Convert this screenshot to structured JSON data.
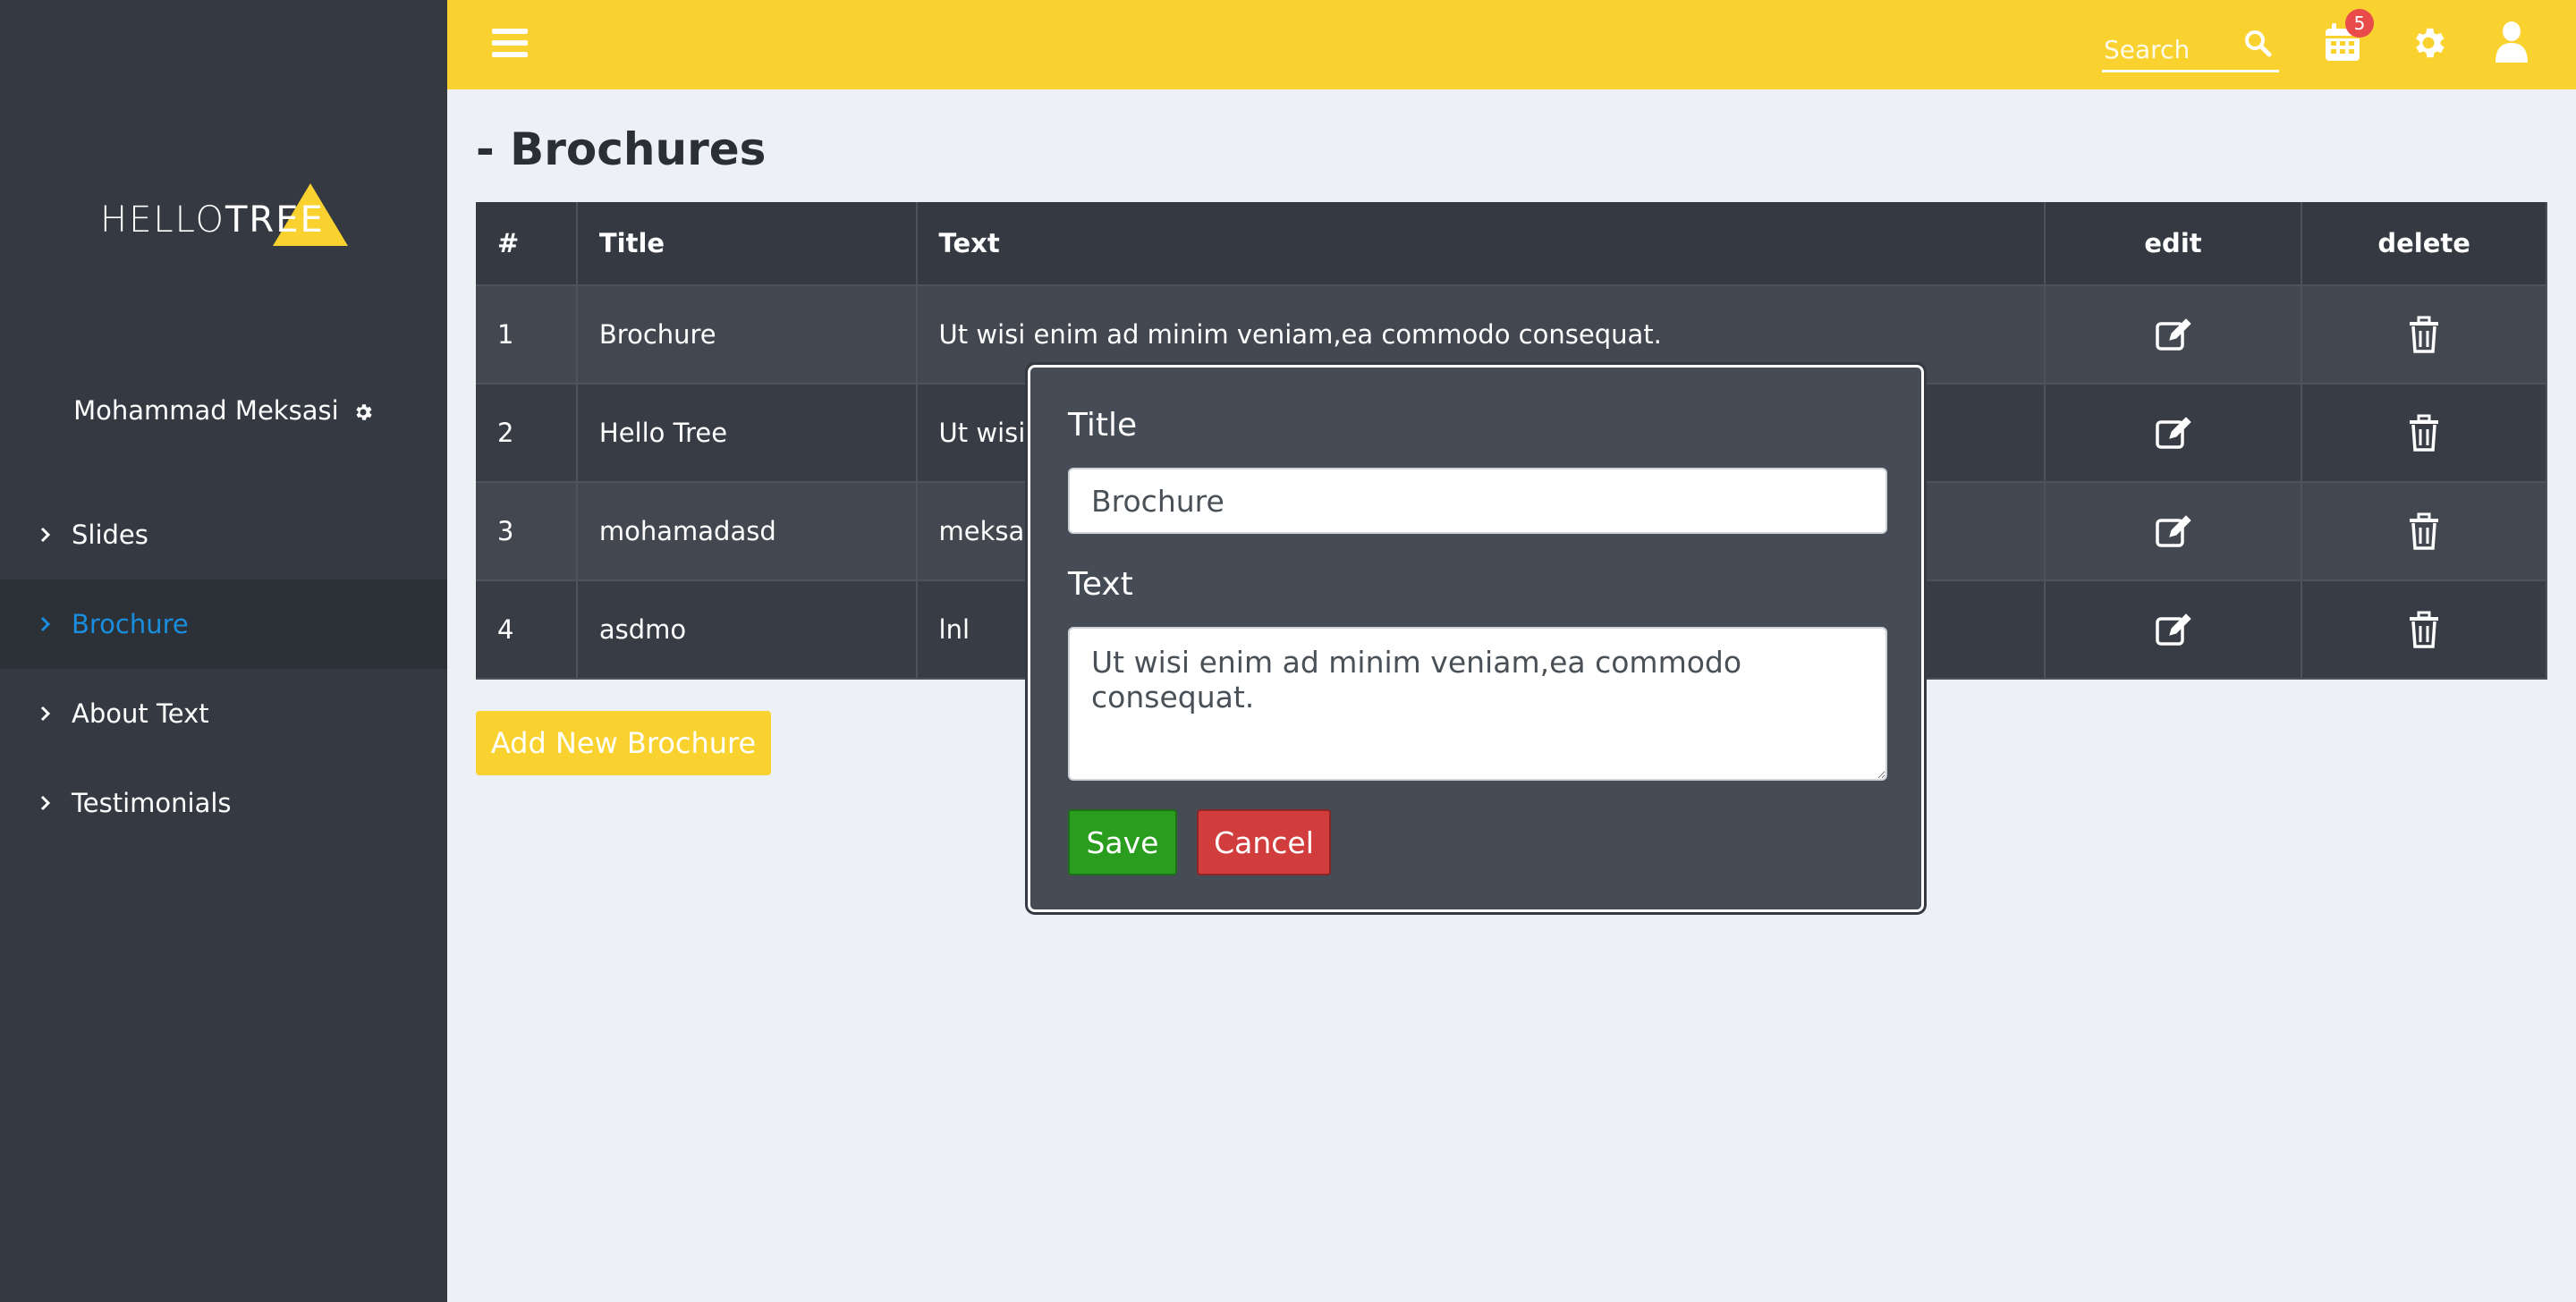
{
  "brand": {
    "logo_text_light": "HELLO",
    "logo_text_bold": "TREE",
    "accent": "#fad22f"
  },
  "user": {
    "name": "Mohammad Meksasi",
    "settings_icon": "gear-icon"
  },
  "sidebar": {
    "items": [
      {
        "label": "Slides",
        "active": false
      },
      {
        "label": "Brochure",
        "active": true
      },
      {
        "label": "About Text",
        "active": false
      },
      {
        "label": "Testimonials",
        "active": false
      }
    ]
  },
  "topbar": {
    "search_placeholder": "Search",
    "notification_count": "5",
    "icons": [
      "menu-icon",
      "search-icon",
      "calendar-icon",
      "gear-icon",
      "user-icon"
    ]
  },
  "page": {
    "title": "- Brochures"
  },
  "table": {
    "headers": {
      "num": "#",
      "title": "Title",
      "text": "Text",
      "edit": "edit",
      "delete": "delete"
    },
    "rows": [
      {
        "num": "1",
        "title": "Brochure",
        "text": "Ut wisi enim ad minim veniam,ea commodo consequat."
      },
      {
        "num": "2",
        "title": "Hello Tree",
        "text": "Ut wisi e"
      },
      {
        "num": "3",
        "title": "mohamadasd",
        "text": "meksas"
      },
      {
        "num": "4",
        "title": "asdmo",
        "text": "lnl"
      }
    ]
  },
  "actions": {
    "add_label": "Add New Brochure"
  },
  "modal": {
    "title_label": "Title",
    "title_value": "Brochure",
    "text_label": "Text",
    "text_value": "Ut wisi enim ad minim veniam,ea commodo consequat.",
    "save_label": "Save",
    "cancel_label": "Cancel"
  },
  "colors": {
    "sidebar_bg": "#353a42",
    "active_link": "#1a8ede",
    "save": "#2a9d1f",
    "cancel": "#d13c3c",
    "badge": "#e94b4b"
  }
}
